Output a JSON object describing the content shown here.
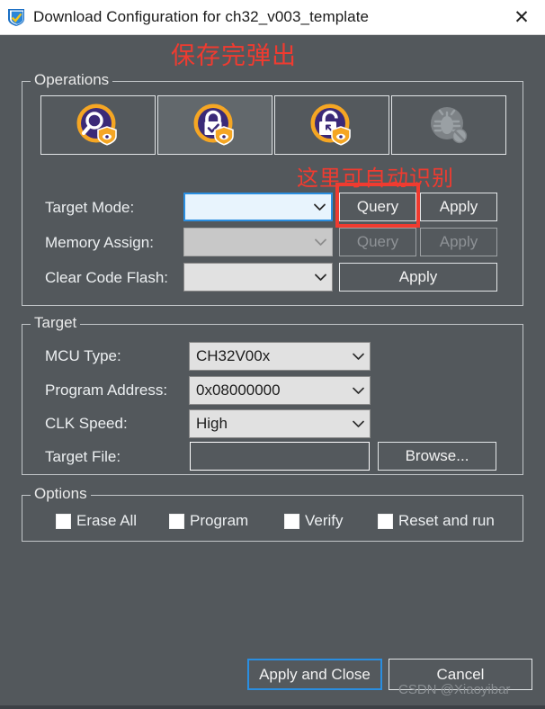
{
  "window": {
    "title": "Download Configuration for ch32_v003_template",
    "icon": "wch-shield-check-icon",
    "close_label": "✕"
  },
  "annotations": [
    {
      "id": "save-popup-note",
      "text": "保存完弹出",
      "color": "#f03b30"
    },
    {
      "id": "auto-detect-note",
      "text": "这里可自动识别",
      "color": "#f03b30"
    }
  ],
  "watermark": "CSDN @Xiaoyibar",
  "operations": {
    "title": "Operations",
    "icon_buttons": [
      {
        "name": "read-config-button",
        "icon": "magnifier-shield-icon",
        "state": "normal"
      },
      {
        "name": "lock-config-button",
        "icon": "lock-check-shield-icon",
        "state": "hover"
      },
      {
        "name": "unlock-config-button",
        "icon": "unlock-shield-icon",
        "state": "normal"
      },
      {
        "name": "debug-disable-button",
        "icon": "bug-disabled-icon",
        "state": "disabled"
      }
    ],
    "rows": [
      {
        "label": "Target Mode:",
        "value": "",
        "state": "focused",
        "buttons": [
          {
            "label": "Query",
            "enabled": true
          },
          {
            "label": "Apply",
            "enabled": true
          }
        ]
      },
      {
        "label": "Memory Assign:",
        "value": "",
        "state": "disabled",
        "buttons": [
          {
            "label": "Query",
            "enabled": false
          },
          {
            "label": "Apply",
            "enabled": false
          }
        ]
      },
      {
        "label": "Clear Code Flash:",
        "value": "",
        "state": "normal",
        "buttons": [
          {
            "label": "Apply",
            "enabled": true
          }
        ]
      }
    ]
  },
  "target": {
    "title": "Target",
    "mcu_type": {
      "label": "MCU Type:",
      "value": "CH32V00x"
    },
    "program_address": {
      "label": "Program Address:",
      "value": "0x08000000"
    },
    "clk_speed": {
      "label": "CLK Speed:",
      "value": "High"
    },
    "target_file": {
      "label": "Target File:",
      "value": "",
      "browse_label": "Browse..."
    }
  },
  "options": {
    "title": "Options",
    "checkboxes": [
      {
        "label": "Erase All",
        "checked": false
      },
      {
        "label": "Program",
        "checked": false
      },
      {
        "label": "Verify",
        "checked": false
      },
      {
        "label": "Reset and run",
        "checked": false
      }
    ]
  },
  "footer": {
    "apply_and_close": "Apply and Close",
    "cancel": "Cancel"
  },
  "colors": {
    "background": "#53585c",
    "titlebar": "#ffffff",
    "accent_blue": "#2a8ee0",
    "annotation_red": "#f03b30",
    "icon_purple": "#3b2a78",
    "icon_orange": "#f5a623"
  }
}
